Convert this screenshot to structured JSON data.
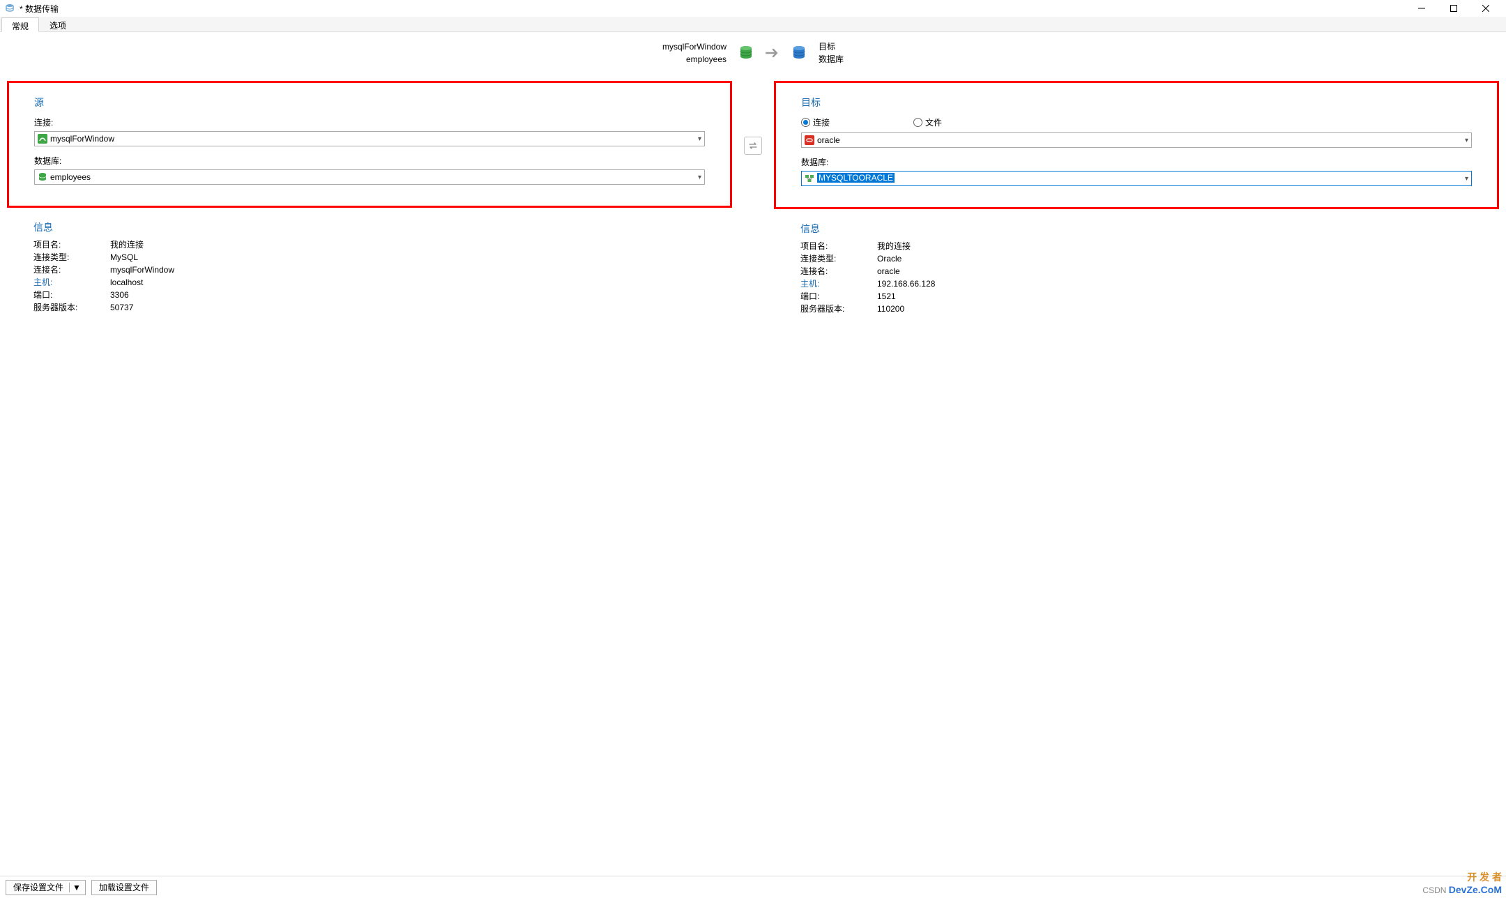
{
  "window": {
    "title": "* 数据传输"
  },
  "tabs": {
    "general": "常规",
    "options": "选项"
  },
  "header": {
    "source_conn": "mysqlForWindow",
    "source_db": "employees",
    "target_label": "目标",
    "target_db_label": "数据库"
  },
  "source": {
    "title": "源",
    "conn_label": "连接:",
    "conn_value": "mysqlForWindow",
    "db_label": "数据库:",
    "db_value": "employees"
  },
  "target": {
    "title": "目标",
    "radio_conn": "连接",
    "radio_file": "文件",
    "conn_value": "oracle",
    "db_label": "数据库:",
    "db_value": "MYSQLTOORACLE"
  },
  "info_left": {
    "title": "信息",
    "rows": {
      "proj_k": "项目名:",
      "proj_v": "我的连接",
      "type_k": "连接类型:",
      "type_v": "MySQL",
      "name_k": "连接名:",
      "name_v": "mysqlForWindow",
      "host_k": "主机:",
      "host_v": "localhost",
      "port_k": "端口:",
      "port_v": "3306",
      "ver_k": "服务器版本:",
      "ver_v": "50737"
    }
  },
  "info_right": {
    "title": "信息",
    "rows": {
      "proj_k": "项目名:",
      "proj_v": "我的连接",
      "type_k": "连接类型:",
      "type_v": "Oracle",
      "name_k": "连接名:",
      "name_v": "oracle",
      "host_k": "主机:",
      "host_v": "192.168.66.128",
      "port_k": "端口:",
      "port_v": "1521",
      "ver_k": "服务器版本:",
      "ver_v": "110200"
    }
  },
  "footer": {
    "save_profile": "保存设置文件",
    "load_profile": "加载设置文件"
  },
  "watermark": {
    "csdn": "CSDN",
    "devze": "DevZe.CoM",
    "kaifa": "开 发 者"
  }
}
